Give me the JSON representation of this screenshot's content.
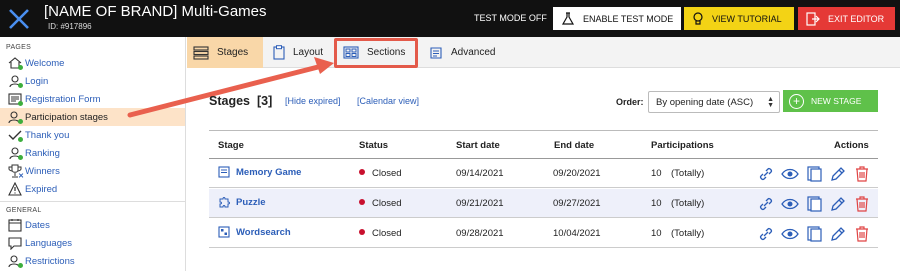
{
  "header": {
    "brand_title": "[NAME OF BRAND] Multi-Games",
    "brand_id": "ID: #917896",
    "test_mode_status": "TEST MODE OFF",
    "enable_test_mode": "ENABLE TEST MODE",
    "view_tutorial": "VIEW TUTORIAL",
    "exit_editor": "EXIT EDITOR"
  },
  "sidebar": {
    "pages_heading": "PAGES",
    "pages": [
      {
        "label": "Welcome"
      },
      {
        "label": "Login"
      },
      {
        "label": "Registration Form"
      },
      {
        "label": "Participation stages"
      },
      {
        "label": "Thank you"
      },
      {
        "label": "Ranking"
      },
      {
        "label": "Winners"
      },
      {
        "label": "Expired"
      }
    ],
    "general_heading": "GENERAL",
    "general": [
      {
        "label": "Dates"
      },
      {
        "label": "Languages"
      },
      {
        "label": "Restrictions"
      }
    ]
  },
  "tabs": [
    {
      "label": "Stages"
    },
    {
      "label": "Layout"
    },
    {
      "label": "Sections"
    },
    {
      "label": "Advanced"
    }
  ],
  "main": {
    "title": "Stages",
    "count": "[3]",
    "hide_expired": "[Hide expired]",
    "calendar_view": "[Calendar view]",
    "order_label": "Order:",
    "order_value": "By opening date (ASC)",
    "new_stage": "NEW STAGE"
  },
  "table": {
    "columns": [
      "Stage",
      "Status",
      "Start date",
      "End date",
      "Participations",
      "Actions"
    ],
    "rows": [
      {
        "name": "Memory Game",
        "status": "Closed",
        "start": "09/14/2021",
        "end": "09/20/2021",
        "count": "10",
        "note": "(Totally)"
      },
      {
        "name": "Puzzle",
        "status": "Closed",
        "start": "09/21/2021",
        "end": "09/27/2021",
        "count": "10",
        "note": "(Totally)"
      },
      {
        "name": "Wordsearch",
        "status": "Closed",
        "start": "09/28/2021",
        "end": "10/04/2021",
        "count": "10",
        "note": "(Totally)"
      }
    ]
  },
  "colors": {
    "accent_blue": "#2c5eb8",
    "highlight_red": "#e35a4a",
    "new_stage_green": "#5fc14a",
    "tutorial_yellow": "#f3d315",
    "exit_red": "#e53936"
  }
}
